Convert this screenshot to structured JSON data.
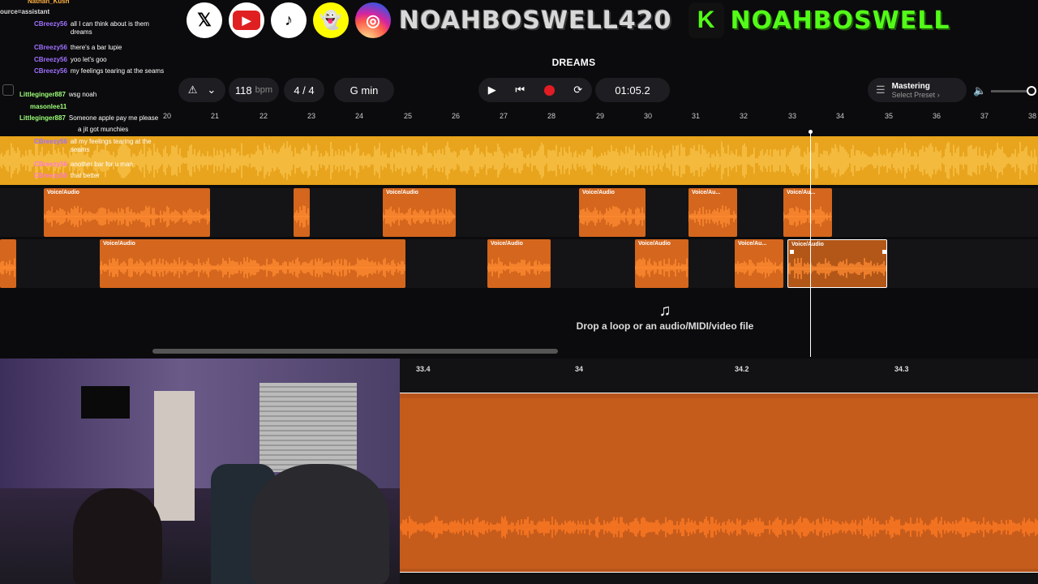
{
  "banner": {
    "socials": [
      "x-logo",
      "youtube-logo",
      "tiktok-logo",
      "snapchat-logo",
      "instagram-logo"
    ],
    "handle_main": "NOAHBOSWELL420",
    "kick_letter": "K",
    "handle_kick": "NOAHBOSWELL"
  },
  "chat": [
    {
      "user": "Nathan_Kush",
      "text": "",
      "color": "orange"
    },
    {
      "user": "ource=assistant",
      "text": "",
      "color": "white"
    },
    {
      "user": "CBreezy56",
      "text": "all I can think about is them dreams",
      "color": "purple"
    },
    {
      "user": "CBreezy56",
      "text": "there's a bar lupie",
      "color": "purple"
    },
    {
      "user": "CBreezy56",
      "text": "yoo let's goo",
      "color": "purple"
    },
    {
      "user": "CBreezy56",
      "text": "my feelings tearing at the seams",
      "color": "purple"
    },
    {
      "user": "Littleginger887",
      "text": "wsg noah",
      "color": "green"
    },
    {
      "user": "masonlee11",
      "text": "",
      "color": "green"
    },
    {
      "user": "Littleginger887",
      "text": "Someone apple pay me please",
      "color": "green"
    },
    {
      "user": "",
      "text": "a jit got munchies",
      "color": "white"
    },
    {
      "user": "CBreezy56",
      "text": "all my feelings tearing at the seams",
      "color": "purple"
    },
    {
      "user": "CBreezy56",
      "text": "another bar for u man",
      "color": "pink"
    },
    {
      "user": "CBreezy56",
      "text": "that better",
      "color": "pink"
    }
  ],
  "daw": {
    "song_title": "DREAMS",
    "bpm": "118",
    "bpm_unit": "bpm",
    "time_sig": "4 / 4",
    "key": "G min",
    "time": "01:05.2",
    "mastering_label": "Mastering",
    "mastering_preset": "Select Preset",
    "ruler": [
      "20",
      "21",
      "22",
      "23",
      "24",
      "25",
      "26",
      "27",
      "28",
      "29",
      "30",
      "31",
      "32",
      "33",
      "34",
      "35",
      "36",
      "37",
      "38"
    ],
    "clip_label": "Voice/Audio",
    "clip_label_short": "Voice/Au...",
    "drop_text": "Drop a loop or an audio/MIDI/video file",
    "zoom_ruler": [
      "33.4",
      "34",
      "34.2",
      "34.3"
    ],
    "colors": {
      "backing_track": "#e8a41c",
      "clip": "#d4661d",
      "record": "#e31b23"
    }
  }
}
